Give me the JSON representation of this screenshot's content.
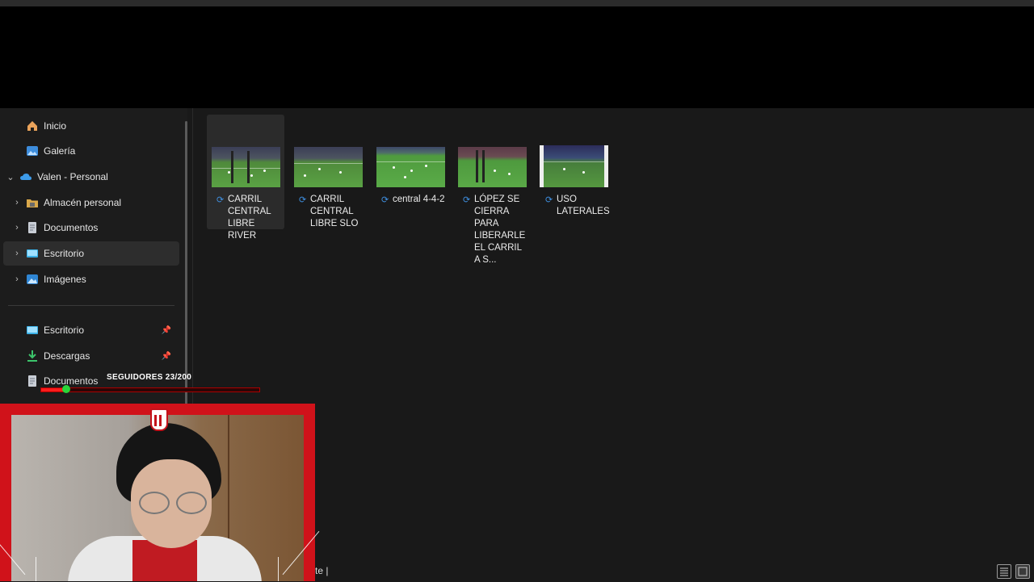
{
  "sidebar": {
    "items": [
      {
        "label": "Inicio",
        "icon": "home-icon",
        "chevron": "",
        "pinned": false
      },
      {
        "label": "Galería",
        "icon": "gallery-icon",
        "chevron": "",
        "pinned": false
      },
      {
        "label": "Valen - Personal",
        "icon": "cloud-icon",
        "chevron": "⌄",
        "pinned": false
      },
      {
        "label": "Almacén personal",
        "icon": "vault-folder-icon",
        "chevron": "›",
        "pinned": false
      },
      {
        "label": "Documentos",
        "icon": "document-icon",
        "chevron": "›",
        "pinned": false
      },
      {
        "label": "Escritorio",
        "icon": "desktop-icon",
        "chevron": "›",
        "pinned": false,
        "selected": true
      },
      {
        "label": "Imágenes",
        "icon": "pictures-icon",
        "chevron": "›",
        "pinned": false
      }
    ],
    "quick_access": [
      {
        "label": "Escritorio",
        "icon": "desktop-icon",
        "pinned": true
      },
      {
        "label": "Descargas",
        "icon": "download-icon",
        "pinned": true
      },
      {
        "label": "Documentos",
        "icon": "document-icon",
        "pinned": true
      }
    ],
    "pin_glyph": "📌"
  },
  "files": [
    {
      "label": "CARRIL CENTRAL LIBRE RIVER",
      "type": "video",
      "sync_icon": "sync-icon",
      "selected": true
    },
    {
      "label": "CARRIL CENTRAL LIBRE SLO",
      "type": "video",
      "sync_icon": "sync-icon"
    },
    {
      "label": "central 4-4-2",
      "type": "video",
      "sync_icon": "sync-icon"
    },
    {
      "label": "LÓPEZ SE CIERRA PARA LIBERARLE EL CARRIL A S...",
      "type": "video",
      "sync_icon": "sync-icon"
    },
    {
      "label": "USO LATERALES",
      "type": "video",
      "sync_icon": "sync-icon"
    }
  ],
  "sync_glyph": "⟳",
  "overlay": {
    "followers_text": "SEGUIDORES 23/200",
    "progress": 0.115,
    "accent_color": "#d0121a",
    "knob_glyph": "✖"
  },
  "statusbar": {
    "text": "te  |"
  },
  "colors": {
    "background": "#191919",
    "sidebar": "#1c1c1c",
    "selection": "#2d2d2d"
  }
}
